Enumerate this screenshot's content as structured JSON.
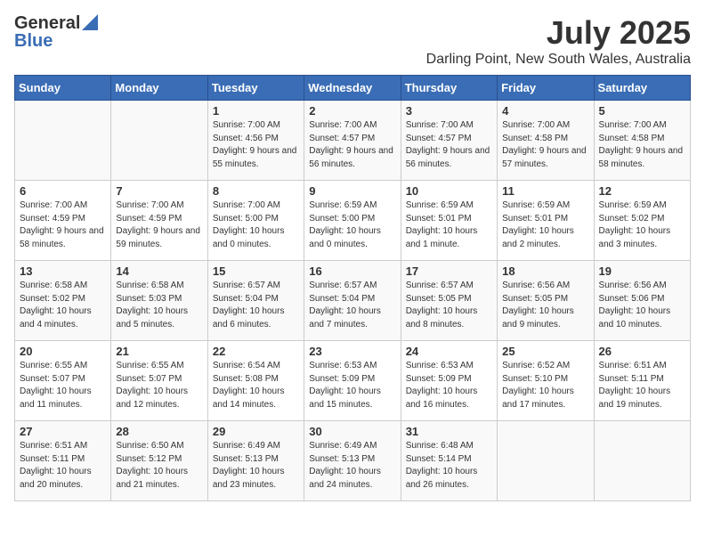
{
  "header": {
    "logo_general": "General",
    "logo_blue": "Blue",
    "month_year": "July 2025",
    "location": "Darling Point, New South Wales, Australia"
  },
  "calendar": {
    "columns": [
      "Sunday",
      "Monday",
      "Tuesday",
      "Wednesday",
      "Thursday",
      "Friday",
      "Saturday"
    ],
    "weeks": [
      [
        {
          "day": "",
          "info": ""
        },
        {
          "day": "",
          "info": ""
        },
        {
          "day": "1",
          "info": "Sunrise: 7:00 AM\nSunset: 4:56 PM\nDaylight: 9 hours and 55 minutes."
        },
        {
          "day": "2",
          "info": "Sunrise: 7:00 AM\nSunset: 4:57 PM\nDaylight: 9 hours and 56 minutes."
        },
        {
          "day": "3",
          "info": "Sunrise: 7:00 AM\nSunset: 4:57 PM\nDaylight: 9 hours and 56 minutes."
        },
        {
          "day": "4",
          "info": "Sunrise: 7:00 AM\nSunset: 4:58 PM\nDaylight: 9 hours and 57 minutes."
        },
        {
          "day": "5",
          "info": "Sunrise: 7:00 AM\nSunset: 4:58 PM\nDaylight: 9 hours and 58 minutes."
        }
      ],
      [
        {
          "day": "6",
          "info": "Sunrise: 7:00 AM\nSunset: 4:59 PM\nDaylight: 9 hours and 58 minutes."
        },
        {
          "day": "7",
          "info": "Sunrise: 7:00 AM\nSunset: 4:59 PM\nDaylight: 9 hours and 59 minutes."
        },
        {
          "day": "8",
          "info": "Sunrise: 7:00 AM\nSunset: 5:00 PM\nDaylight: 10 hours and 0 minutes."
        },
        {
          "day": "9",
          "info": "Sunrise: 6:59 AM\nSunset: 5:00 PM\nDaylight: 10 hours and 0 minutes."
        },
        {
          "day": "10",
          "info": "Sunrise: 6:59 AM\nSunset: 5:01 PM\nDaylight: 10 hours and 1 minute."
        },
        {
          "day": "11",
          "info": "Sunrise: 6:59 AM\nSunset: 5:01 PM\nDaylight: 10 hours and 2 minutes."
        },
        {
          "day": "12",
          "info": "Sunrise: 6:59 AM\nSunset: 5:02 PM\nDaylight: 10 hours and 3 minutes."
        }
      ],
      [
        {
          "day": "13",
          "info": "Sunrise: 6:58 AM\nSunset: 5:02 PM\nDaylight: 10 hours and 4 minutes."
        },
        {
          "day": "14",
          "info": "Sunrise: 6:58 AM\nSunset: 5:03 PM\nDaylight: 10 hours and 5 minutes."
        },
        {
          "day": "15",
          "info": "Sunrise: 6:57 AM\nSunset: 5:04 PM\nDaylight: 10 hours and 6 minutes."
        },
        {
          "day": "16",
          "info": "Sunrise: 6:57 AM\nSunset: 5:04 PM\nDaylight: 10 hours and 7 minutes."
        },
        {
          "day": "17",
          "info": "Sunrise: 6:57 AM\nSunset: 5:05 PM\nDaylight: 10 hours and 8 minutes."
        },
        {
          "day": "18",
          "info": "Sunrise: 6:56 AM\nSunset: 5:05 PM\nDaylight: 10 hours and 9 minutes."
        },
        {
          "day": "19",
          "info": "Sunrise: 6:56 AM\nSunset: 5:06 PM\nDaylight: 10 hours and 10 minutes."
        }
      ],
      [
        {
          "day": "20",
          "info": "Sunrise: 6:55 AM\nSunset: 5:07 PM\nDaylight: 10 hours and 11 minutes."
        },
        {
          "day": "21",
          "info": "Sunrise: 6:55 AM\nSunset: 5:07 PM\nDaylight: 10 hours and 12 minutes."
        },
        {
          "day": "22",
          "info": "Sunrise: 6:54 AM\nSunset: 5:08 PM\nDaylight: 10 hours and 14 minutes."
        },
        {
          "day": "23",
          "info": "Sunrise: 6:53 AM\nSunset: 5:09 PM\nDaylight: 10 hours and 15 minutes."
        },
        {
          "day": "24",
          "info": "Sunrise: 6:53 AM\nSunset: 5:09 PM\nDaylight: 10 hours and 16 minutes."
        },
        {
          "day": "25",
          "info": "Sunrise: 6:52 AM\nSunset: 5:10 PM\nDaylight: 10 hours and 17 minutes."
        },
        {
          "day": "26",
          "info": "Sunrise: 6:51 AM\nSunset: 5:11 PM\nDaylight: 10 hours and 19 minutes."
        }
      ],
      [
        {
          "day": "27",
          "info": "Sunrise: 6:51 AM\nSunset: 5:11 PM\nDaylight: 10 hours and 20 minutes."
        },
        {
          "day": "28",
          "info": "Sunrise: 6:50 AM\nSunset: 5:12 PM\nDaylight: 10 hours and 21 minutes."
        },
        {
          "day": "29",
          "info": "Sunrise: 6:49 AM\nSunset: 5:13 PM\nDaylight: 10 hours and 23 minutes."
        },
        {
          "day": "30",
          "info": "Sunrise: 6:49 AM\nSunset: 5:13 PM\nDaylight: 10 hours and 24 minutes."
        },
        {
          "day": "31",
          "info": "Sunrise: 6:48 AM\nSunset: 5:14 PM\nDaylight: 10 hours and 26 minutes."
        },
        {
          "day": "",
          "info": ""
        },
        {
          "day": "",
          "info": ""
        }
      ]
    ]
  }
}
